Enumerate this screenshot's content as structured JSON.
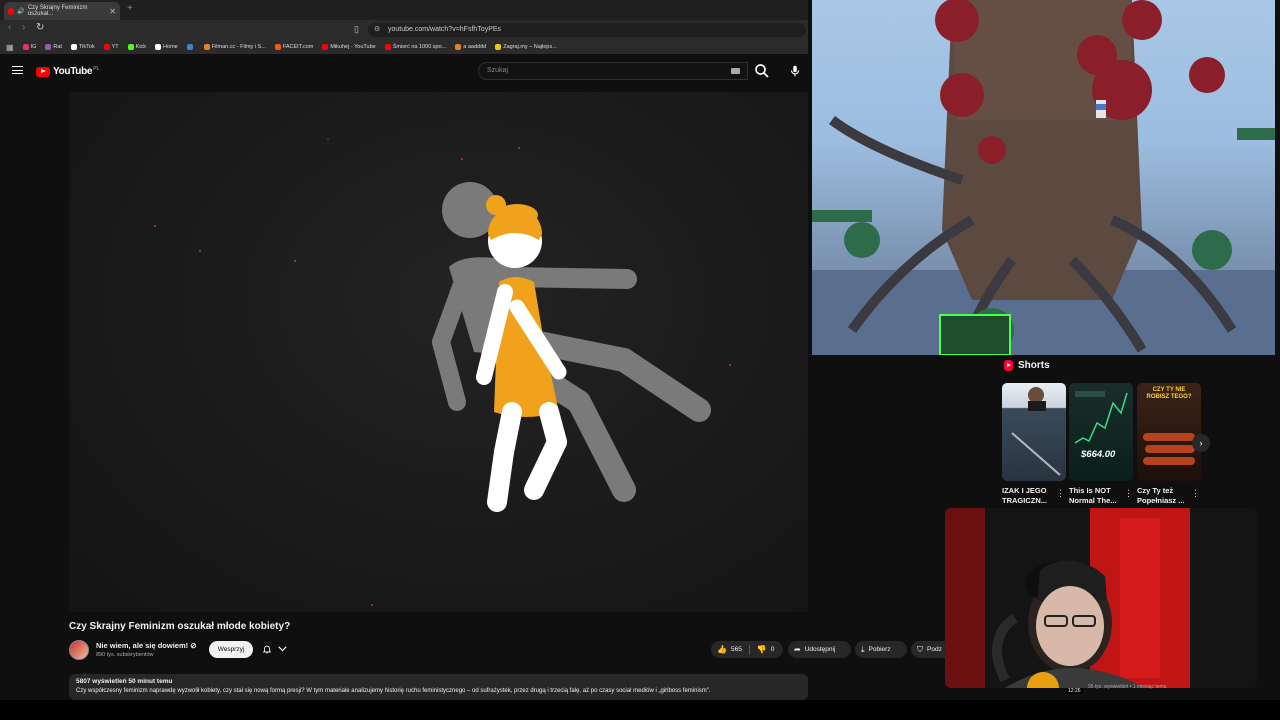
{
  "browser": {
    "tab_title": "Czy Skrajny Feminizm oszukał...",
    "url": "youtube.com/watch?v=hFsfhToyPEs",
    "bookmarks": [
      {
        "label": "IG",
        "color": "#e1306c"
      },
      {
        "label": "Rat",
        "color": "#9b59b6"
      },
      {
        "label": "TikTok",
        "color": "#ffffff"
      },
      {
        "label": "YT",
        "color": "#ff0000"
      },
      {
        "label": "Kick",
        "color": "#53fc18"
      },
      {
        "label": "Home",
        "color": "#ffffff"
      },
      {
        "label": "",
        "color": "#3d85c6"
      },
      {
        "label": "Filman.cc - Filmy i S...",
        "color": "#e67e22"
      },
      {
        "label": "FACEIT.com",
        "color": "#ff5500"
      },
      {
        "label": "Mikuhej - YouTube",
        "color": "#ff0000"
      },
      {
        "label": "Śmierć na 1000 spo...",
        "color": "#ff0000"
      },
      {
        "label": "a aadddd",
        "color": "#e67e22"
      },
      {
        "label": "Zagraj.my – Najleps...",
        "color": "#f1c40f"
      }
    ]
  },
  "youtube": {
    "logo_text": "YouTube",
    "logo_region": "PL",
    "search_placeholder": "Szukaj"
  },
  "video": {
    "title": "Czy Skrajny Feminizm oszukał młode kobiety?",
    "channel_name": "Nie wiem, ale się dowiem! ⊘",
    "subscribers": "890 tys. subskrybentów",
    "support_label": "Wesprzyj",
    "likes": "565",
    "dislikes": "0",
    "share_label": "Udostępnij",
    "download_label": "Pobierz",
    "more_label": "Podz",
    "views_time": "5807 wyświetleń  50 minut temu",
    "description": "Czy współczesny feminizm naprawdę wyzwolił kobiety, czy stał się nową formą presji? W tym materiale analizujemy historię ruchu feministycznego – od sufrażystek, przez drugą i trzecią falę, aż po czasy social mediów i „girlboss feminism\"."
  },
  "shorts": {
    "heading": "Shorts",
    "items": [
      {
        "title": "IZAK I JEGO TRAGICZN...",
        "art": "#3a4a5a"
      },
      {
        "title": "This Is NOT Normal The...",
        "overlay": "$664.00",
        "art": "#0d2a25"
      },
      {
        "title": "Czy Ty też Popełniasz ...",
        "overlay": "CZY TY NIE ROBISZ TEGO?",
        "art": "#2a1510"
      }
    ]
  },
  "sidebar_tail": {
    "duration": "12:26",
    "meta": "95 tys. wyświetleń • 1 miesiąc temu"
  },
  "colors": {
    "yt_red": "#ff0000",
    "figure_orange": "#f0a21c",
    "ghost_gray": "#7a7a7a"
  }
}
